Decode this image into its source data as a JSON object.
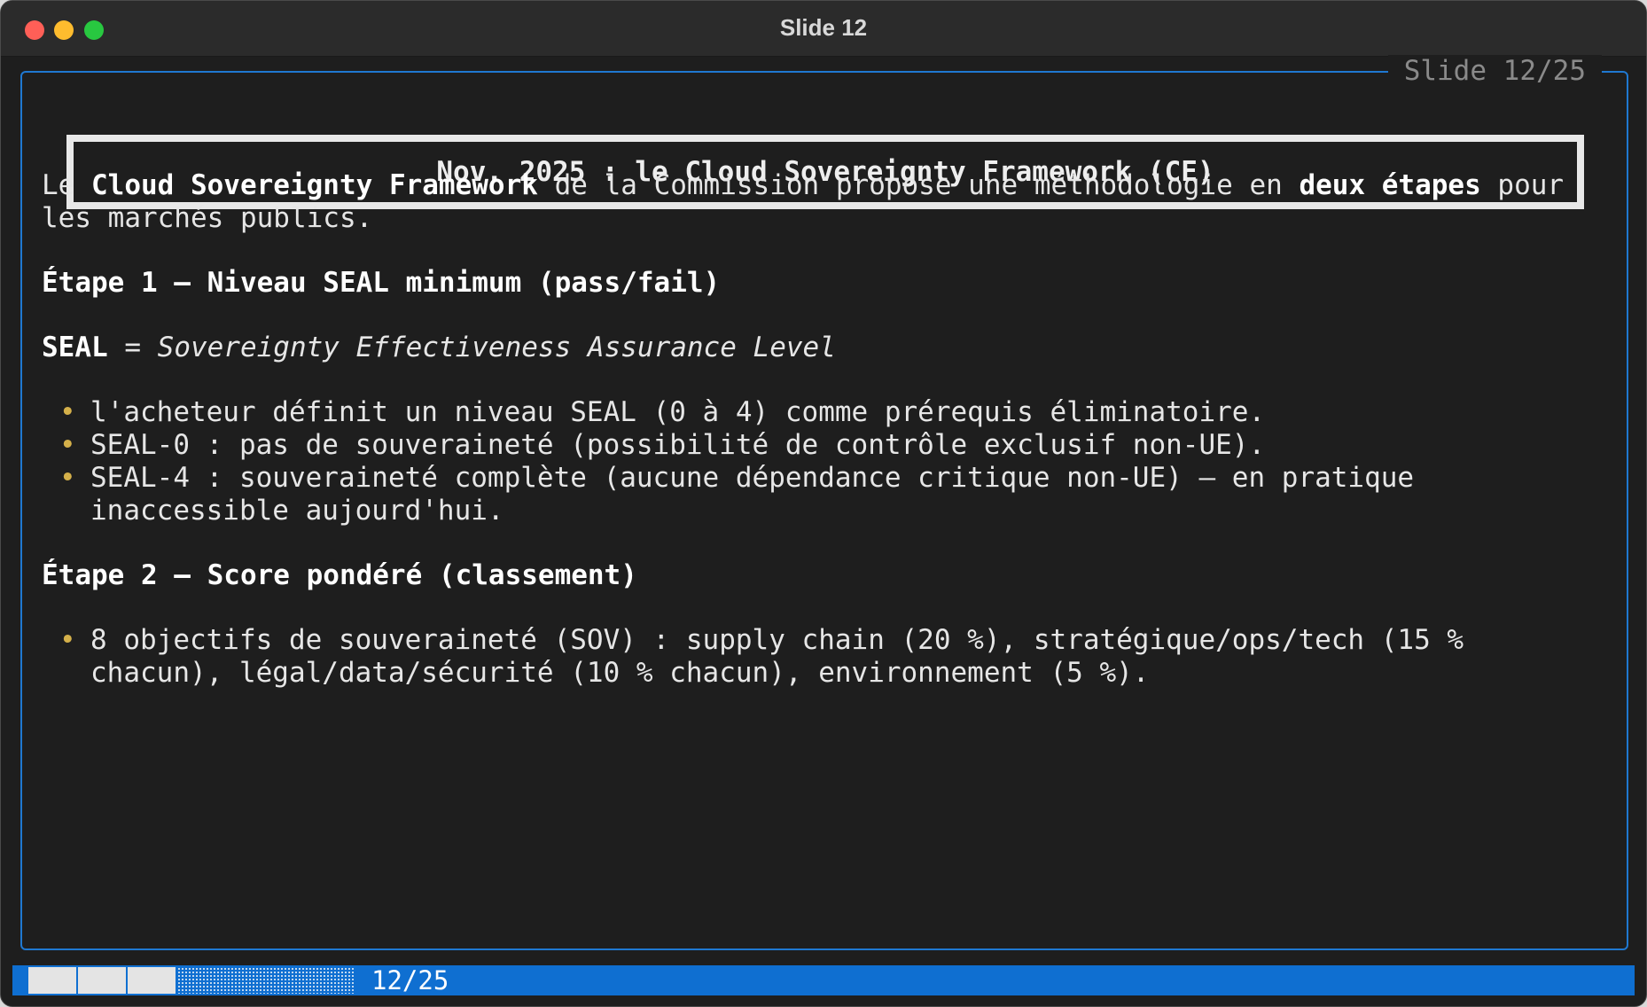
{
  "window": {
    "title": "Slide 12"
  },
  "slide": {
    "counter": "Slide 12/25",
    "heading": "Nov. 2025 : le Cloud Sovereignty Framework (CE)",
    "intro": {
      "t1": "Le ",
      "b1": "Cloud Sovereignty Framework",
      "t2": " de la Commission propose une méthodologie en ",
      "b2": "deux étapes",
      "t3": " pour les marchés publics."
    },
    "step1": {
      "heading": "Étape 1 — Niveau SEAL minimum (pass/fail)",
      "seal_term": "SEAL",
      "seal_eq": " = ",
      "seal_def": "Sovereignty Effectiveness Assurance Level",
      "bullets": [
        "l'acheteur définit un niveau SEAL (0 à 4) comme prérequis éliminatoire.",
        "SEAL-0 : pas de souveraineté (possibilité de contrôle exclusif non-UE).",
        "SEAL-4 : souveraineté complète (aucune dépendance critique non-UE) — en pratique inaccessible aujourd'hui."
      ]
    },
    "step2": {
      "heading": "Étape 2 — Score pondéré (classement)",
      "bullets": [
        "8 objectifs de souveraineté (SOV) : supply chain (20 %), stratégique/ops/tech (15 % chacun), légal/data/sécurité (10 % chacun), environnement (5 %)."
      ]
    }
  },
  "statusbar": {
    "progress_text": "12/25",
    "progress_fraction": 0.48,
    "accent_color": "#0f6fd1",
    "frame_color": "#1f78d1",
    "bullet_color": "#d4b04a"
  }
}
